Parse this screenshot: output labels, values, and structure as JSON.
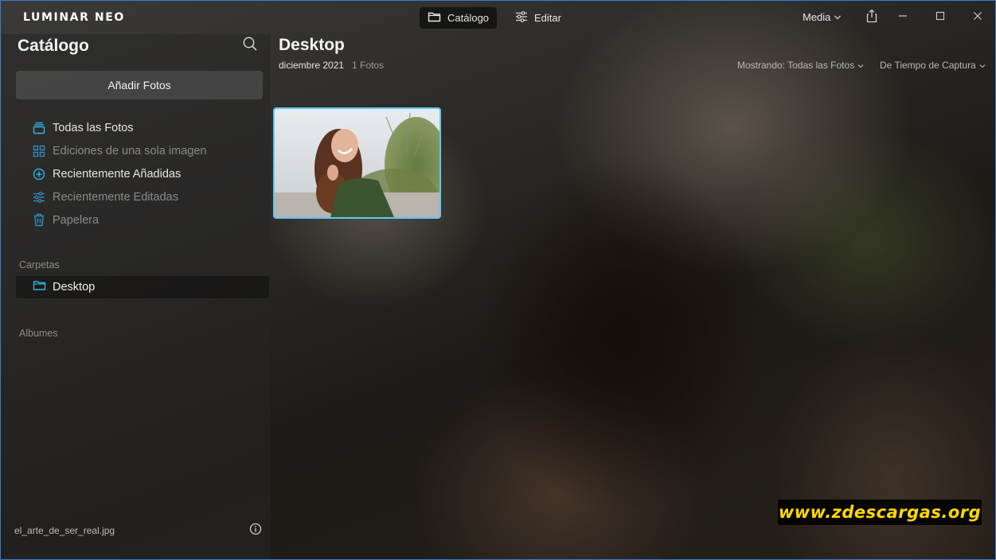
{
  "app": {
    "logo": "LUMINAR NEO",
    "tabs": [
      {
        "label": "Catálogo",
        "icon": "folder-icon",
        "active": true
      },
      {
        "label": "Editar",
        "icon": "sliders-icon",
        "active": false
      }
    ],
    "media_menu": "Media",
    "window_controls": [
      "share-icon",
      "minimize-icon",
      "maximize-icon",
      "close-icon"
    ]
  },
  "sidebar": {
    "title": "Catálogo",
    "add_photos_label": "Añadir Fotos",
    "nav_items": [
      {
        "label": "Todas las Fotos",
        "icon": "all-photos-icon",
        "enabled": true
      },
      {
        "label": "Ediciones de una sola imagen",
        "icon": "grid-icon",
        "enabled": false
      },
      {
        "label": "Recientemente Añadidas",
        "icon": "plus-circle-icon",
        "enabled": true
      },
      {
        "label": "Recientemente Editadas",
        "icon": "sliders-icon",
        "enabled": false
      },
      {
        "label": "Papelera",
        "icon": "trash-icon",
        "enabled": false
      }
    ],
    "folders_label": "Carpetas",
    "folders": [
      {
        "label": "Desktop",
        "icon": "folder-icon",
        "selected": true
      }
    ],
    "albums_label": "Albumes",
    "file_name": "el_arte_de_ser_real.jpg"
  },
  "main": {
    "title": "Desktop",
    "date": "diciembre 2021",
    "count": "1 Fotos",
    "filter_label": "Mostrando: Todas las Fotos",
    "sort_label": "De Tiempo de Captura",
    "photos": [
      {
        "selected": true
      }
    ]
  },
  "watermark": "www.zdescargas.org",
  "colors": {
    "accent": "#2fb3e8",
    "selection_border": "#5ec8f2",
    "watermark_text": "#ffd700"
  }
}
